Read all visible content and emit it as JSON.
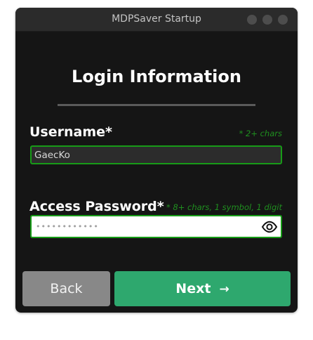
{
  "window": {
    "title": "MDPSaver Startup"
  },
  "heading": "Login Information",
  "username": {
    "label": "Username*",
    "hint": "* 2+ chars",
    "value": "GaecKo"
  },
  "password": {
    "label": "Access Password*",
    "hint": "* 8+ chars, 1 symbol, 1 digit",
    "masked_value": "••••••••••••"
  },
  "buttons": {
    "back": "Back",
    "next": "Next",
    "next_arrow": "→"
  },
  "icons": {
    "password_toggle": "eye-icon",
    "window_controls": [
      "minimize-dot",
      "maximize-dot",
      "close-dot"
    ]
  },
  "colors": {
    "accent_green": "#2ea86e",
    "valid_border": "#179b17",
    "hint_text": "#1f8f1f",
    "back_button": "#888888"
  }
}
